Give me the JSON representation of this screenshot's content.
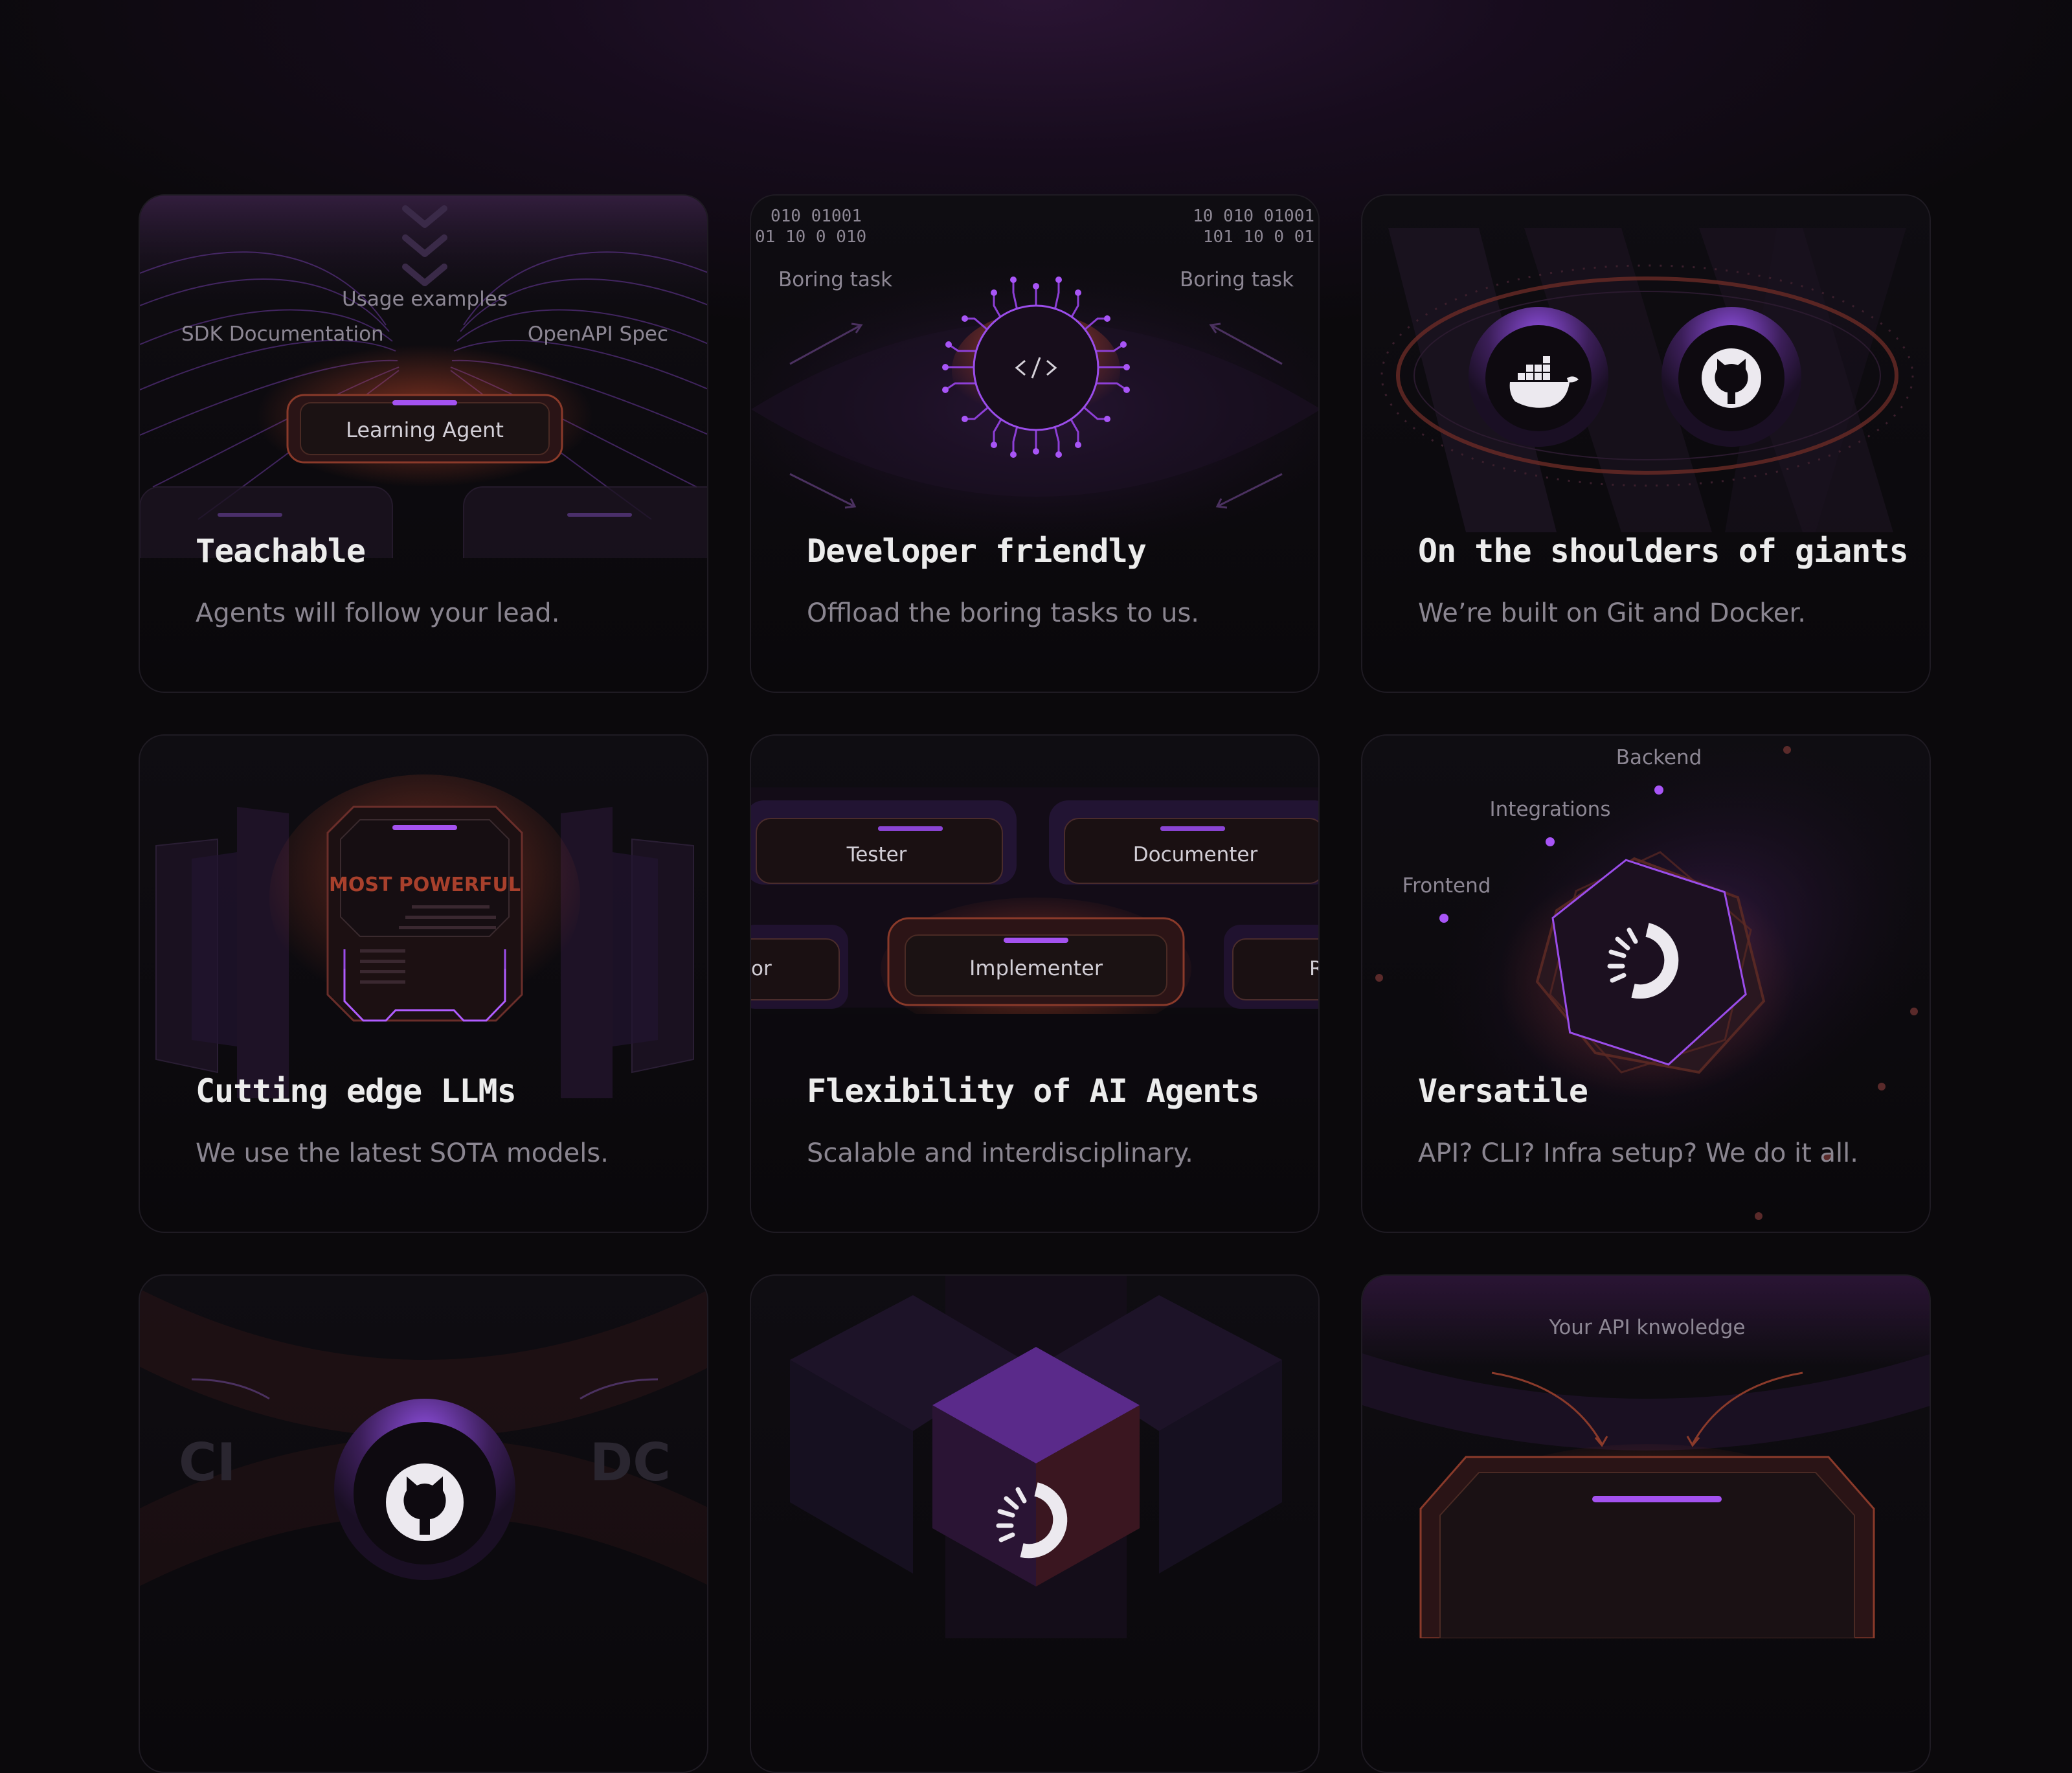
{
  "colors": {
    "accent": "#9b4dea",
    "accent_bright": "#b56cff",
    "warm": "#e0522f",
    "title": "#ececec",
    "desc": "#8a8590",
    "card_border": "#1f1b23"
  },
  "cards": [
    {
      "title": "Teachable",
      "description": "Agents will follow your lead.",
      "labels": {
        "usage": "Usage examples",
        "sdk": "SDK Documentation",
        "openapi": "OpenAPI Spec",
        "agent": "Learning Agent"
      },
      "icons": [
        "chevron-down-icon"
      ]
    },
    {
      "title": "Developer friendly",
      "description": "Offload the boring tasks to us.",
      "labels": {
        "boring_left": "Boring task",
        "boring_right": "Boring task",
        "binary_left_1": "010 01001",
        "binary_left_2": "01 10 0 010",
        "binary_right_1": "10 010 01001",
        "binary_right_2": "101 10 0 01"
      },
      "icons": [
        "code-chip-icon"
      ]
    },
    {
      "title": "On the shoulders of giants",
      "description": "We’re built on Git and Docker.",
      "icons": [
        "docker-icon",
        "github-icon"
      ]
    },
    {
      "title": "Cutting edge LLMs",
      "description": "We use the latest SOTA models.",
      "labels": {
        "badge": "MOST POWERFUL"
      },
      "icons": [
        "chip-icon"
      ]
    },
    {
      "title": "Flexibility of AI Agents",
      "description": "Scalable and interdisciplinary.",
      "labels": {
        "tester": "Tester",
        "documenter": "Documenter",
        "implementer": "Implementer",
        "left_cut": "or",
        "right_cut": "R"
      }
    },
    {
      "title": "Versatile",
      "description": "API? CLI? Infra setup? We do it all.",
      "labels": {
        "backend": "Backend",
        "integrations": "Integrations",
        "frontend": "Frontend"
      },
      "icons": [
        "loader-icon"
      ]
    },
    {
      "labels": {
        "ci": "CI",
        "dc": "DC"
      },
      "icons": [
        "github-icon"
      ]
    },
    {
      "icons": [
        "loader-icon"
      ]
    },
    {
      "labels": {
        "api_knowledge": "Your API knwoledge"
      }
    }
  ]
}
